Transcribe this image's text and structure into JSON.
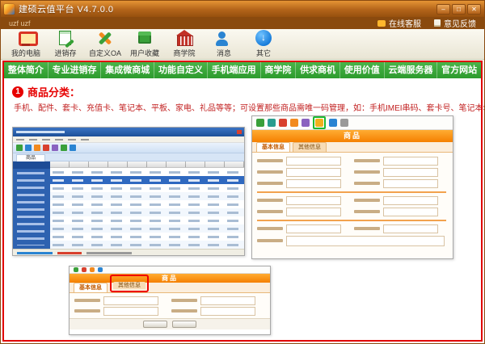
{
  "window": {
    "title": "建硕云值平台  V4.7.0.0",
    "controls": {
      "minimize": "–",
      "maximize": "□",
      "close": "✕"
    }
  },
  "substrip": {
    "left_text": "uzf uzf",
    "links": [
      {
        "label": "在线客服"
      },
      {
        "label": "意见反馈"
      }
    ]
  },
  "toolbar": {
    "items": [
      {
        "label": "我的电脑",
        "icon": "computer-icon"
      },
      {
        "label": "进销存",
        "icon": "invoice-doc-icon"
      },
      {
        "label": "自定义OA",
        "icon": "crossed-tools-icon"
      },
      {
        "label": "用户收藏",
        "icon": "package-box-icon"
      },
      {
        "label": "商学院",
        "icon": "school-building-icon"
      },
      {
        "label": "消息",
        "icon": "message-person-icon"
      },
      {
        "label": "其它",
        "icon": "down-arrow-circle-icon",
        "glyph": "↓"
      }
    ]
  },
  "nav": {
    "items": [
      "整体简介",
      "专业进销存",
      "集成微商城",
      "功能自定义",
      "手机端应用",
      "商学院",
      "供求商机",
      "使用价值",
      "云端服务器",
      "官方网站"
    ]
  },
  "content": {
    "badge": "1",
    "heading": "商品分类：",
    "description": "手机、配件、套卡、充值卡、笔记本、平板、家电、礼品等等；可设置那些商品需唯一码管理，如：手机IMEI串码、套卡号、笔记本SN码等"
  },
  "screenshots": {
    "grid_app": {
      "tab": "商品"
    },
    "product_form": {
      "title": "商品",
      "tabs": [
        "基本信息",
        "其他信息"
      ]
    },
    "product_form2": {
      "title": "商品",
      "tabs": [
        "基本信息",
        "其他信息"
      ]
    }
  },
  "colors": {
    "titlebar": "#b3641a",
    "nav_green": "#2d9b2d",
    "frame_red": "#e00000",
    "banner_orange": "#f57f00"
  }
}
